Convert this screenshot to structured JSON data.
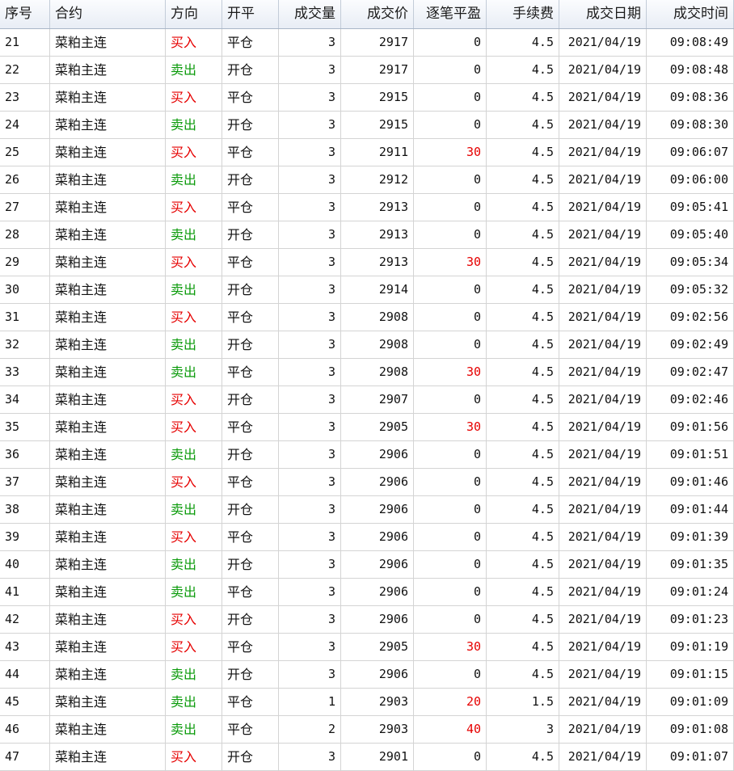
{
  "headers": [
    "序号",
    "合约",
    "方向",
    "开平",
    "成交量",
    "成交价",
    "逐笔平盈",
    "手续费",
    "成交日期",
    "成交时间"
  ],
  "rows": [
    [
      "21",
      "菜粕主连",
      "买入",
      "平仓",
      "3",
      "2917",
      "0",
      "4.5",
      "2021/04/19",
      "09:08:49"
    ],
    [
      "22",
      "菜粕主连",
      "卖出",
      "开仓",
      "3",
      "2917",
      "0",
      "4.5",
      "2021/04/19",
      "09:08:48"
    ],
    [
      "23",
      "菜粕主连",
      "买入",
      "平仓",
      "3",
      "2915",
      "0",
      "4.5",
      "2021/04/19",
      "09:08:36"
    ],
    [
      "24",
      "菜粕主连",
      "卖出",
      "开仓",
      "3",
      "2915",
      "0",
      "4.5",
      "2021/04/19",
      "09:08:30"
    ],
    [
      "25",
      "菜粕主连",
      "买入",
      "平仓",
      "3",
      "2911",
      "30",
      "4.5",
      "2021/04/19",
      "09:06:07"
    ],
    [
      "26",
      "菜粕主连",
      "卖出",
      "开仓",
      "3",
      "2912",
      "0",
      "4.5",
      "2021/04/19",
      "09:06:00"
    ],
    [
      "27",
      "菜粕主连",
      "买入",
      "平仓",
      "3",
      "2913",
      "0",
      "4.5",
      "2021/04/19",
      "09:05:41"
    ],
    [
      "28",
      "菜粕主连",
      "卖出",
      "开仓",
      "3",
      "2913",
      "0",
      "4.5",
      "2021/04/19",
      "09:05:40"
    ],
    [
      "29",
      "菜粕主连",
      "买入",
      "平仓",
      "3",
      "2913",
      "30",
      "4.5",
      "2021/04/19",
      "09:05:34"
    ],
    [
      "30",
      "菜粕主连",
      "卖出",
      "开仓",
      "3",
      "2914",
      "0",
      "4.5",
      "2021/04/19",
      "09:05:32"
    ],
    [
      "31",
      "菜粕主连",
      "买入",
      "平仓",
      "3",
      "2908",
      "0",
      "4.5",
      "2021/04/19",
      "09:02:56"
    ],
    [
      "32",
      "菜粕主连",
      "卖出",
      "开仓",
      "3",
      "2908",
      "0",
      "4.5",
      "2021/04/19",
      "09:02:49"
    ],
    [
      "33",
      "菜粕主连",
      "卖出",
      "平仓",
      "3",
      "2908",
      "30",
      "4.5",
      "2021/04/19",
      "09:02:47"
    ],
    [
      "34",
      "菜粕主连",
      "买入",
      "开仓",
      "3",
      "2907",
      "0",
      "4.5",
      "2021/04/19",
      "09:02:46"
    ],
    [
      "35",
      "菜粕主连",
      "买入",
      "平仓",
      "3",
      "2905",
      "30",
      "4.5",
      "2021/04/19",
      "09:01:56"
    ],
    [
      "36",
      "菜粕主连",
      "卖出",
      "开仓",
      "3",
      "2906",
      "0",
      "4.5",
      "2021/04/19",
      "09:01:51"
    ],
    [
      "37",
      "菜粕主连",
      "买入",
      "平仓",
      "3",
      "2906",
      "0",
      "4.5",
      "2021/04/19",
      "09:01:46"
    ],
    [
      "38",
      "菜粕主连",
      "卖出",
      "开仓",
      "3",
      "2906",
      "0",
      "4.5",
      "2021/04/19",
      "09:01:44"
    ],
    [
      "39",
      "菜粕主连",
      "买入",
      "平仓",
      "3",
      "2906",
      "0",
      "4.5",
      "2021/04/19",
      "09:01:39"
    ],
    [
      "40",
      "菜粕主连",
      "卖出",
      "开仓",
      "3",
      "2906",
      "0",
      "4.5",
      "2021/04/19",
      "09:01:35"
    ],
    [
      "41",
      "菜粕主连",
      "卖出",
      "平仓",
      "3",
      "2906",
      "0",
      "4.5",
      "2021/04/19",
      "09:01:24"
    ],
    [
      "42",
      "菜粕主连",
      "买入",
      "开仓",
      "3",
      "2906",
      "0",
      "4.5",
      "2021/04/19",
      "09:01:23"
    ],
    [
      "43",
      "菜粕主连",
      "买入",
      "平仓",
      "3",
      "2905",
      "30",
      "4.5",
      "2021/04/19",
      "09:01:19"
    ],
    [
      "44",
      "菜粕主连",
      "卖出",
      "开仓",
      "3",
      "2906",
      "0",
      "4.5",
      "2021/04/19",
      "09:01:15"
    ],
    [
      "45",
      "菜粕主连",
      "卖出",
      "平仓",
      "1",
      "2903",
      "20",
      "1.5",
      "2021/04/19",
      "09:01:09"
    ],
    [
      "46",
      "菜粕主连",
      "卖出",
      "平仓",
      "2",
      "2903",
      "40",
      "3",
      "2021/04/19",
      "09:01:08"
    ],
    [
      "47",
      "菜粕主连",
      "买入",
      "开仓",
      "3",
      "2901",
      "0",
      "4.5",
      "2021/04/19",
      "09:01:07"
    ]
  ],
  "colors": {
    "buy": "#e60000",
    "sell": "#0a9a0a",
    "profit": "#e60000"
  }
}
